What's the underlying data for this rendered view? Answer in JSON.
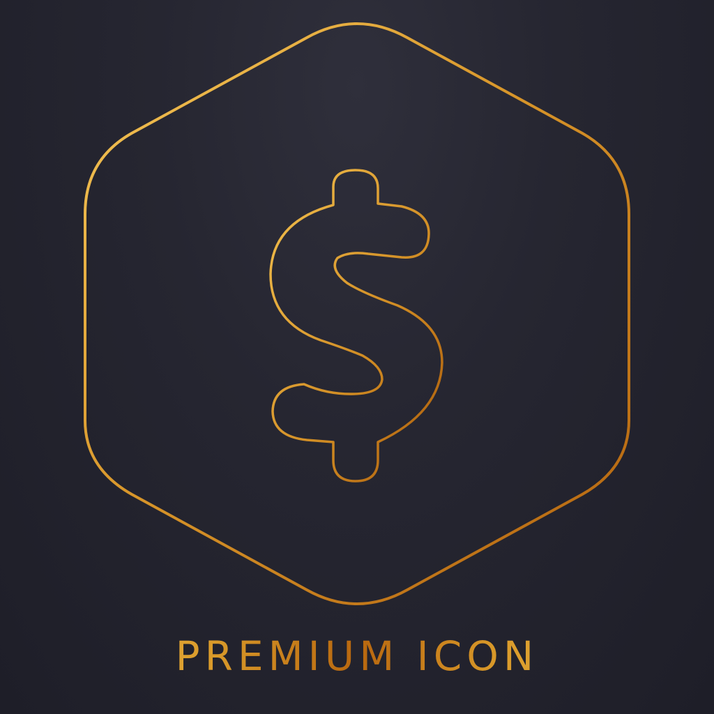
{
  "caption": "PREMIUM ICON",
  "icon": {
    "outer_shape": "hexagon-outline-icon",
    "symbol": "dollar-sign-icon"
  },
  "colors": {
    "background": "#262631",
    "gold_light": "#f3c450",
    "gold_dark": "#b8670f"
  }
}
